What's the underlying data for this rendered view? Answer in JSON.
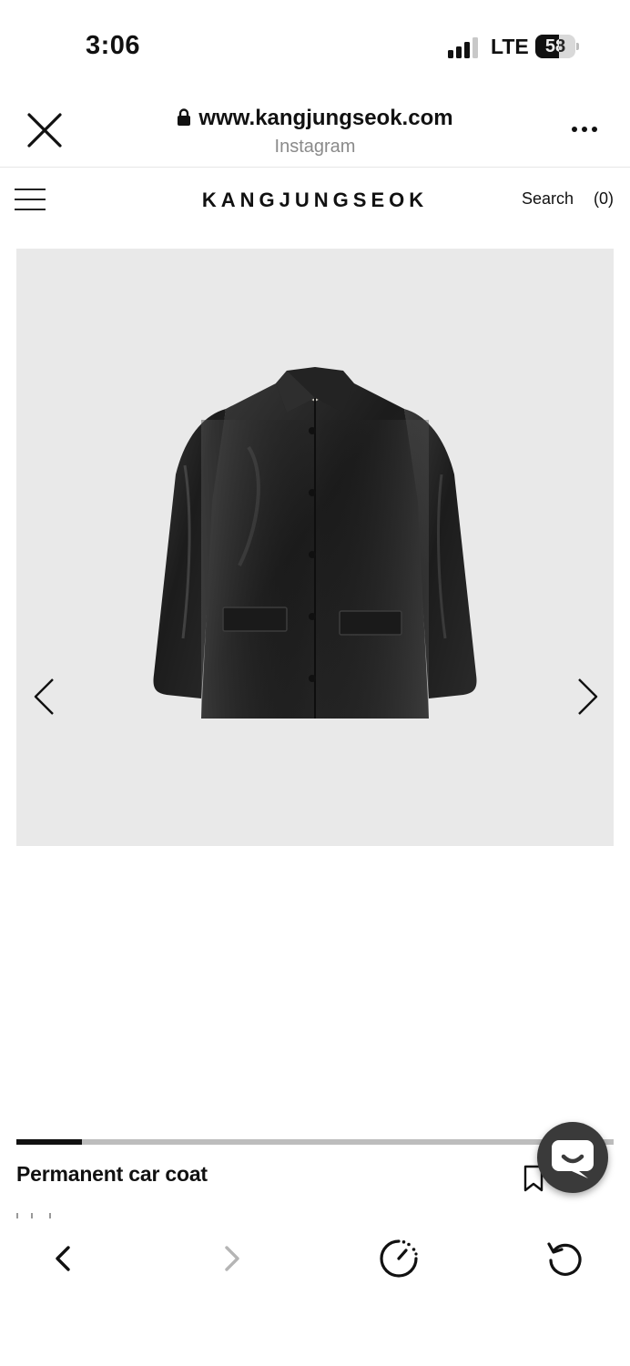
{
  "status_bar": {
    "time": "3:06",
    "network": "LTE",
    "battery": "58",
    "battery_level": 0.58
  },
  "browser": {
    "url": "www.kangjungseok.com",
    "source": "Instagram"
  },
  "site": {
    "brand": "KANGJUNGSEOK",
    "search_label": "Search",
    "cart_label": "(0)"
  },
  "product": {
    "title": "Permanent car coat",
    "gallery_progress": 0.11
  },
  "icons": {
    "close": "close-icon",
    "lock": "lock-icon",
    "more": "more-icon",
    "menu": "hamburger-icon",
    "prev": "chevron-left-icon",
    "next": "chevron-right-icon",
    "bookmark": "bookmark-icon",
    "chat": "chat-icon",
    "back": "back-icon",
    "forward": "forward-icon",
    "speed": "speed-icon",
    "reload": "reload-icon"
  },
  "colors": {
    "image_background": "#e9e9e9",
    "progress_track": "#bdbdbd",
    "progress_fill": "#111111",
    "chat_button": "#3a3a3a"
  }
}
